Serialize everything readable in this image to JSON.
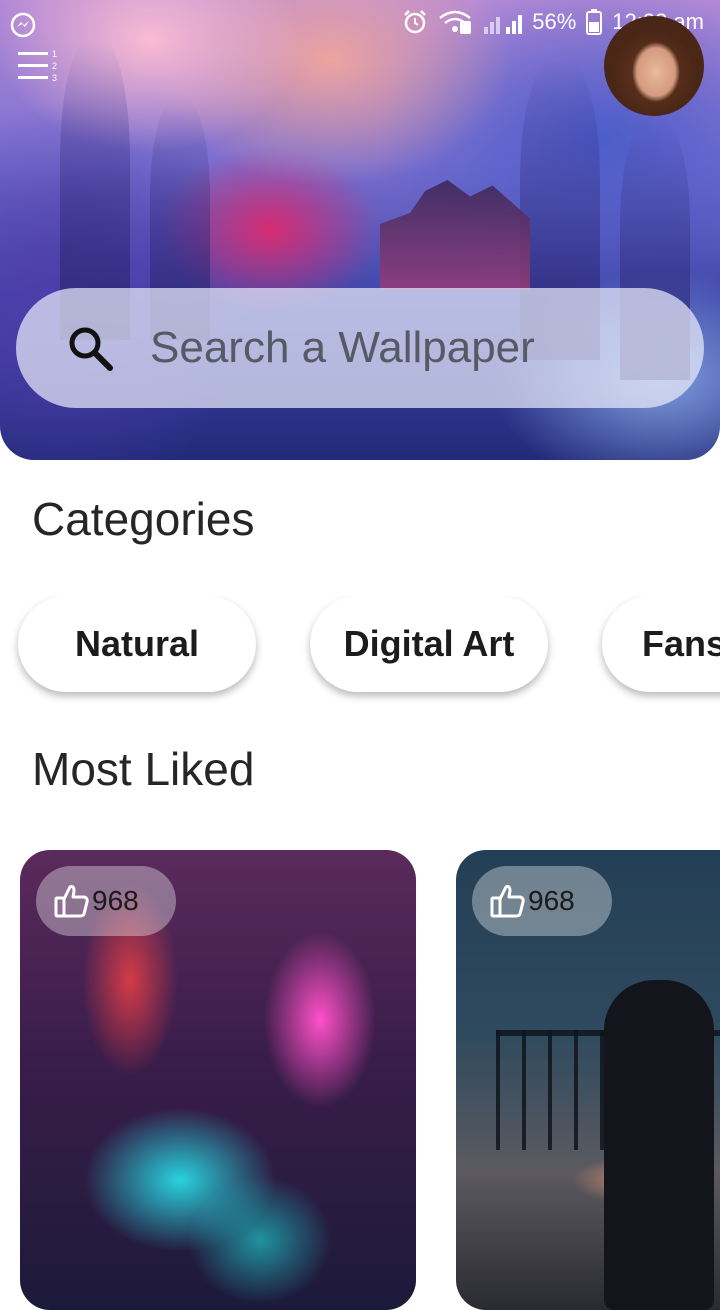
{
  "status_bar": {
    "battery": "56%",
    "time": "12:23 am",
    "icons": [
      "messenger-icon",
      "alarm-icon",
      "wifi-icon",
      "signal-icon",
      "battery-icon"
    ]
  },
  "header": {
    "menu_icon": "menu-icon",
    "avatar_icon": "avatar"
  },
  "search": {
    "placeholder": "Search a Wallpaper",
    "value": "",
    "icon": "search-icon"
  },
  "categories": {
    "title": "Categories",
    "items": [
      {
        "label": "Natural"
      },
      {
        "label": "Digital Art"
      },
      {
        "label": "Fans"
      }
    ]
  },
  "most_liked": {
    "title": "Most Liked",
    "cards": [
      {
        "likes": "968",
        "icon": "thumbs-up-icon"
      },
      {
        "likes": "968",
        "icon": "thumbs-up-icon"
      }
    ]
  }
}
